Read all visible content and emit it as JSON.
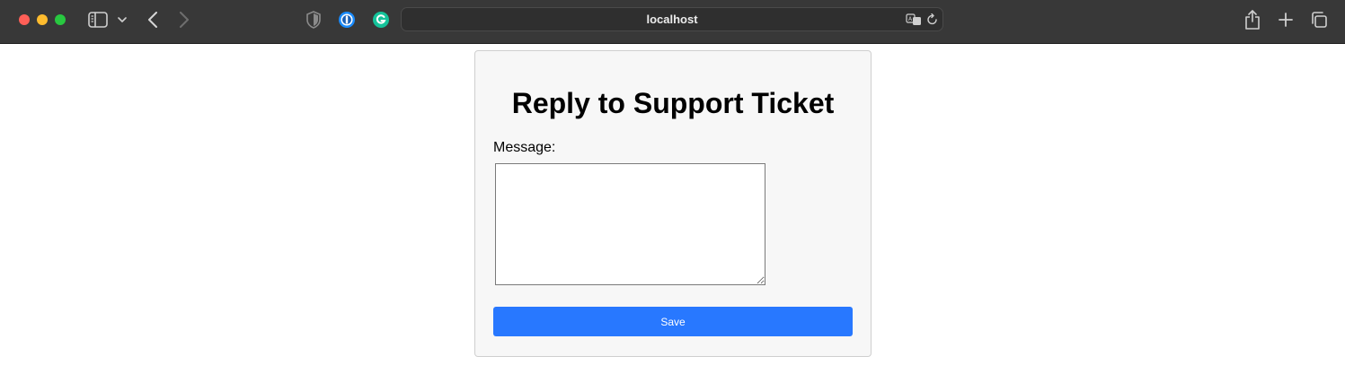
{
  "browser": {
    "address": "localhost",
    "traffic_colors": {
      "close": "#ff5f57",
      "minimize": "#febc2e",
      "zoom": "#28c840"
    },
    "icons": [
      "sidebar-icon",
      "chevron-down-icon",
      "back-icon",
      "forward-icon",
      "shield-icon",
      "onepassword-icon",
      "grammarly-icon",
      "translate-icon",
      "reload-icon",
      "share-icon",
      "new-tab-icon",
      "tabs-overview-icon"
    ]
  },
  "page": {
    "title": "Reply to Support Ticket",
    "message_label": "Message:",
    "message_value": "",
    "save_label": "Save",
    "accent_color": "#2878ff"
  }
}
